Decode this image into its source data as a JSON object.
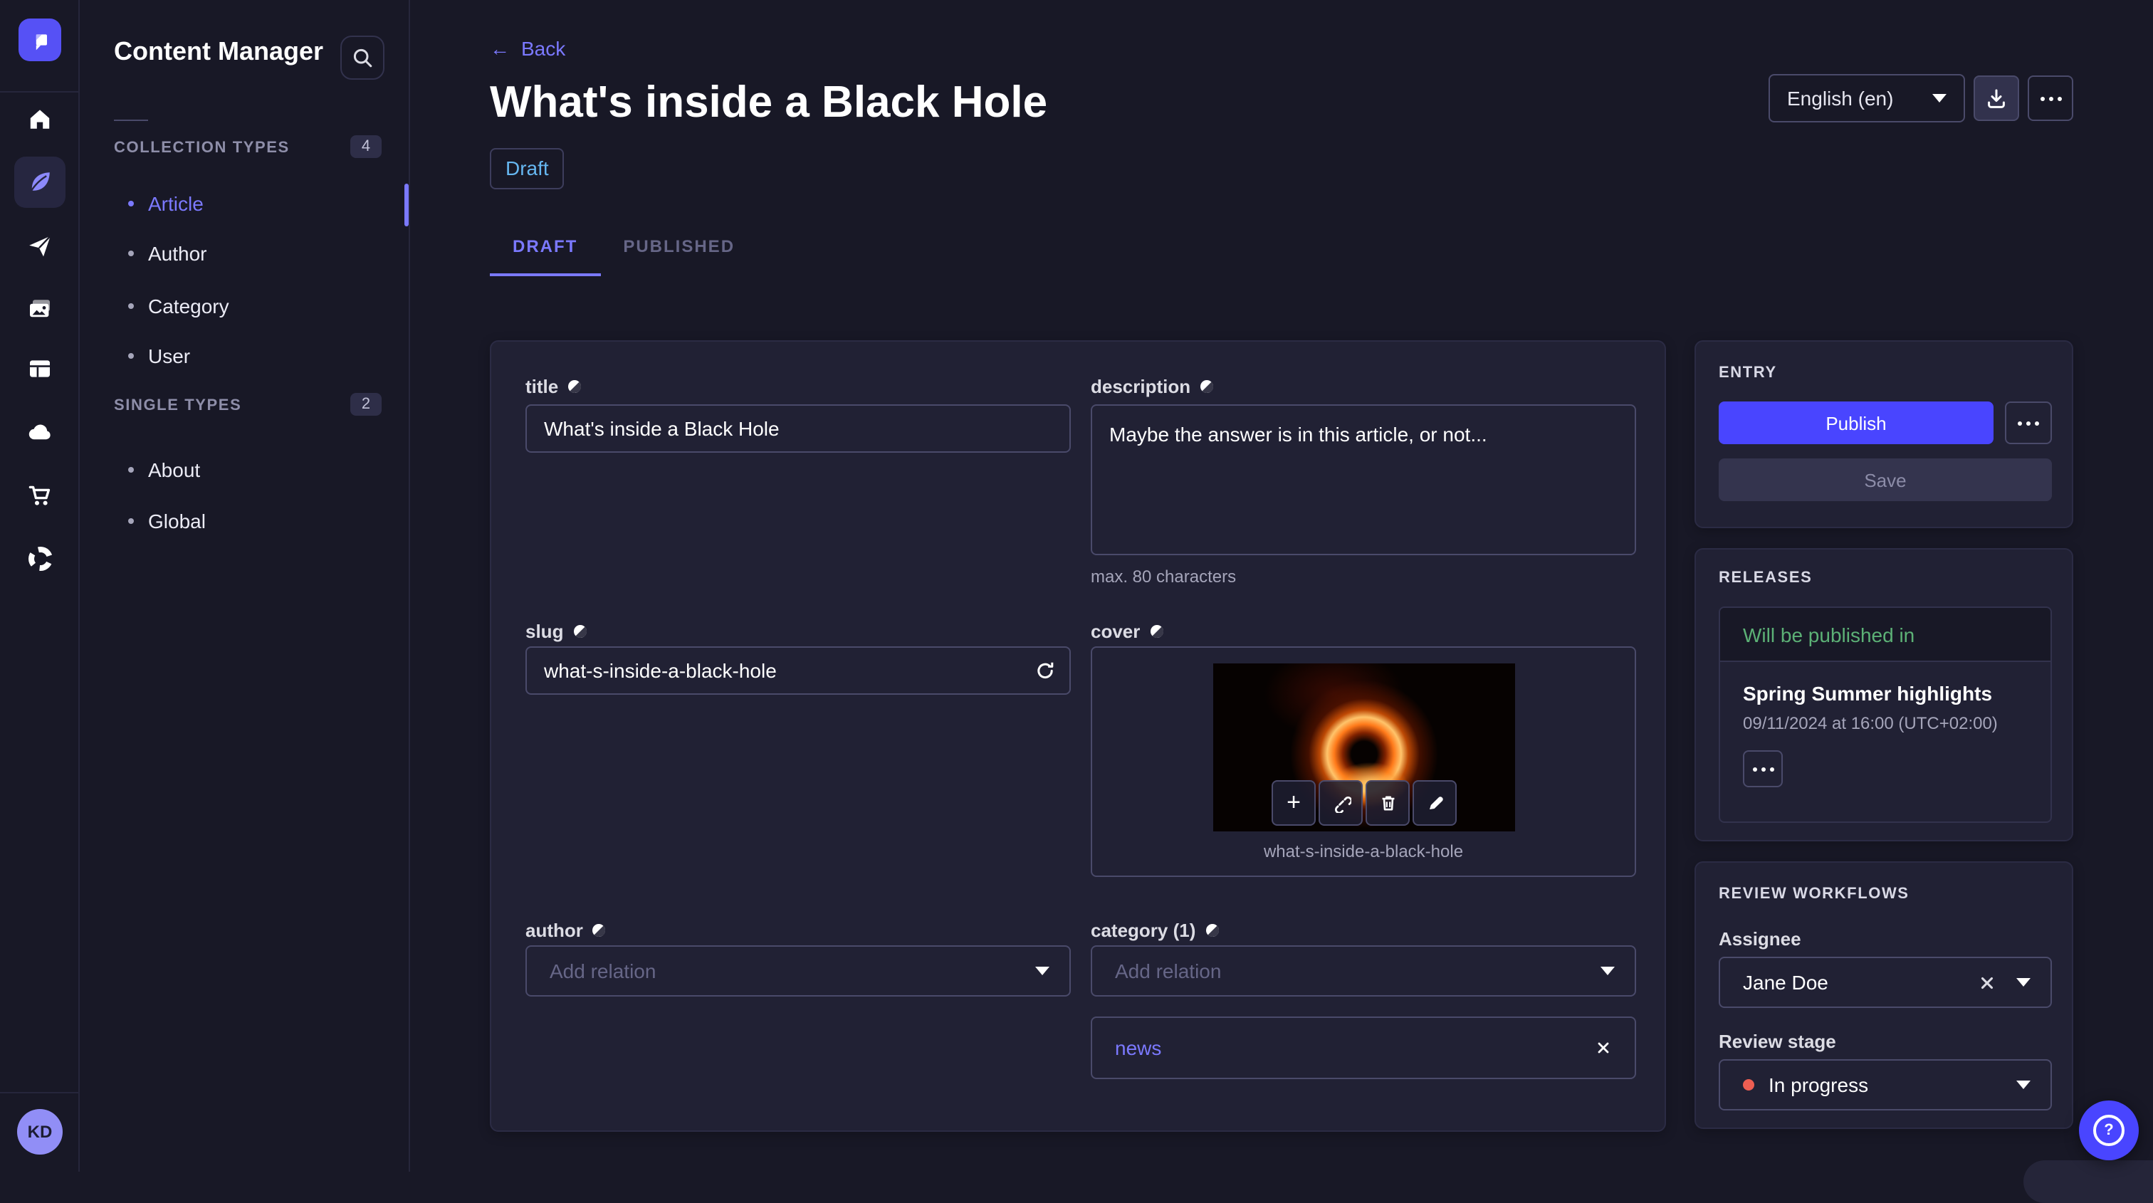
{
  "icons": {
    "back_arrow": "←",
    "plus": "+",
    "question": "?"
  },
  "rail": {
    "avatar": "KD"
  },
  "sidebar": {
    "title": "Content Manager",
    "sections": [
      {
        "label": "COLLECTION TYPES",
        "count": "4",
        "items": [
          {
            "label": "Article",
            "active": true
          },
          {
            "label": "Author"
          },
          {
            "label": "Category"
          },
          {
            "label": "User"
          }
        ]
      },
      {
        "label": "SINGLE TYPES",
        "count": "2",
        "items": [
          {
            "label": "About"
          },
          {
            "label": "Global"
          }
        ]
      }
    ]
  },
  "header": {
    "back": "Back",
    "title": "What's inside a Black Hole",
    "status": "Draft",
    "tabs": [
      {
        "label": "DRAFT",
        "active": true
      },
      {
        "label": "PUBLISHED"
      }
    ],
    "locale": "English (en)"
  },
  "form": {
    "title": {
      "label": "title",
      "value": "What's inside a Black Hole"
    },
    "description": {
      "label": "description",
      "value": "Maybe the answer is in this article, or not...",
      "hint": "max. 80 characters"
    },
    "slug": {
      "label": "slug",
      "value": "what-s-inside-a-black-hole"
    },
    "cover": {
      "label": "cover",
      "filename": "what-s-inside-a-black-hole"
    },
    "author": {
      "label": "author",
      "placeholder": "Add relation"
    },
    "category": {
      "label": "category (1)",
      "placeholder": "Add relation",
      "tag": "news"
    }
  },
  "entry": {
    "title": "ENTRY",
    "publish": "Publish",
    "save": "Save"
  },
  "releases": {
    "title": "RELEASES",
    "header": "Will be published in",
    "name": "Spring Summer highlights",
    "date": "09/11/2024 at 16:00 (UTC+02:00)"
  },
  "review": {
    "title": "REVIEW WORKFLOWS",
    "assignee_label": "Assignee",
    "assignee": "Jane Doe",
    "stage_label": "Review stage",
    "stage": "In progress"
  },
  "colors": {
    "primary": "#4945ff",
    "primary_light": "#7b79ff",
    "draft_blue": "#66b7f1",
    "success_green": "#5cb176",
    "danger_red": "#ee5e52",
    "page_bg": "#181826",
    "card_bg": "#212134"
  }
}
